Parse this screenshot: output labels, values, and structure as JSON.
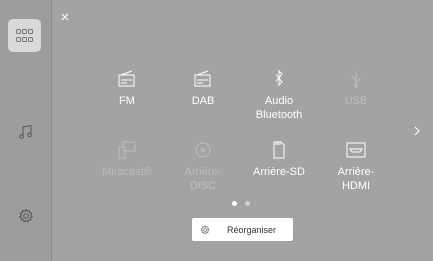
{
  "colors": {
    "screen_bg": "#a3a3a3",
    "sidebar_bg": "#9d9d9d",
    "active_text": "#ffffff",
    "disabled_text": "#bdbdbd",
    "dot_active": "#ffffff",
    "dot_inactive": "#d0d0d0"
  },
  "sidebar": {
    "apps_icon": "grid-icon",
    "music_icon": "music-note-icon",
    "settings_icon": "gear-icon"
  },
  "sources": [
    {
      "id": "fm",
      "label": "FM",
      "icon": "radio-icon",
      "enabled": true
    },
    {
      "id": "dab",
      "label": "DAB",
      "icon": "radio-icon",
      "enabled": true
    },
    {
      "id": "audio-bluetooth",
      "label": "Audio\nBluetooth",
      "icon": "bluetooth-icon",
      "enabled": true
    },
    {
      "id": "usb",
      "label": "USB",
      "icon": "usb-icon",
      "enabled": false
    },
    {
      "id": "miracast",
      "label": "Miracast®",
      "icon": "miracast-icon",
      "enabled": false
    },
    {
      "id": "arriere-disc",
      "label": "Arrière-\nDISC",
      "icon": "disc-icon",
      "enabled": false
    },
    {
      "id": "arriere-sd",
      "label": "Arrière-SD",
      "icon": "sd-card-icon",
      "enabled": true
    },
    {
      "id": "arriere-hdmi",
      "label": "Arrière-\nHDMI",
      "icon": "hdmi-icon",
      "enabled": true
    }
  ],
  "pagination": {
    "current_page": 1,
    "total_pages": 2
  },
  "reorder_button": {
    "label": "Réorganiser",
    "icon": "gear-icon"
  }
}
